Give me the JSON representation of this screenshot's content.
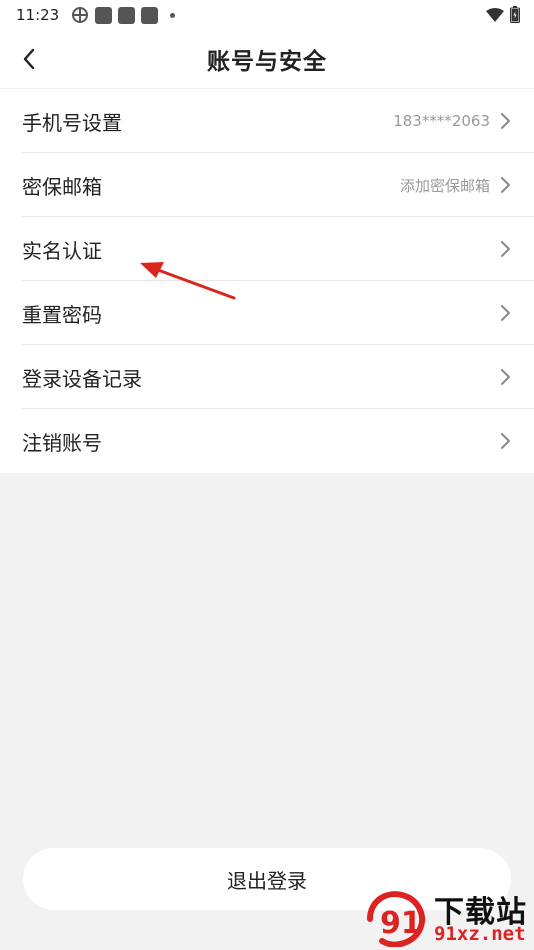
{
  "status_bar": {
    "time": "11:23"
  },
  "header": {
    "title": "账号与安全"
  },
  "settings": [
    {
      "label": "手机号设置",
      "value": "183****2063"
    },
    {
      "label": "密保邮箱",
      "value": "添加密保邮箱"
    },
    {
      "label": "实名认证",
      "value": ""
    },
    {
      "label": "重置密码",
      "value": ""
    },
    {
      "label": "登录设备记录",
      "value": ""
    },
    {
      "label": "注销账号",
      "value": ""
    }
  ],
  "logout": {
    "label": "退出登录"
  },
  "watermark": {
    "text_cn": "下载站",
    "text_url": "91xz.net",
    "logo_text": "91"
  },
  "colors": {
    "background": "#f2f2f2",
    "card": "#ffffff",
    "arrow": "#d9261c",
    "muted_text": "#999999"
  },
  "icons": [
    "back-arrow-icon",
    "chevron-right-icon",
    "wifi-icon",
    "battery-icon",
    "notification-square-icon"
  ]
}
